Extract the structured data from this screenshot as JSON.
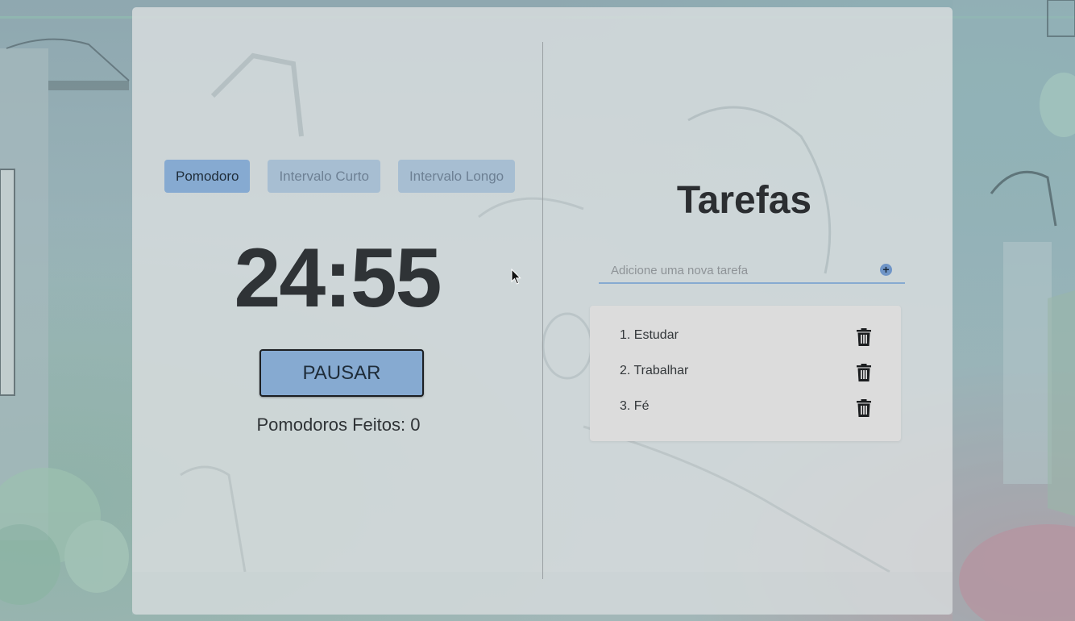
{
  "timer": {
    "modes": [
      "Pomodoro",
      "Intervalo Curto",
      "Intervalo Longo"
    ],
    "active_mode": "Pomodoro",
    "time": "24:55",
    "pause_label": "PAUSAR",
    "completed_label": "Pomodoros Feitos: 0"
  },
  "tasks": {
    "title": "Tarefas",
    "input_placeholder": "Adicione uma nova tarefa",
    "add_icon": "plus-circle-icon",
    "delete_icon": "trash-icon",
    "items": [
      {
        "label": "1. Estudar"
      },
      {
        "label": "2. Trabalhar"
      },
      {
        "label": "3. Fé"
      }
    ]
  },
  "colors": {
    "accent": "#86aad1",
    "text": "#2f3336",
    "panel": "#dcdcdc"
  }
}
